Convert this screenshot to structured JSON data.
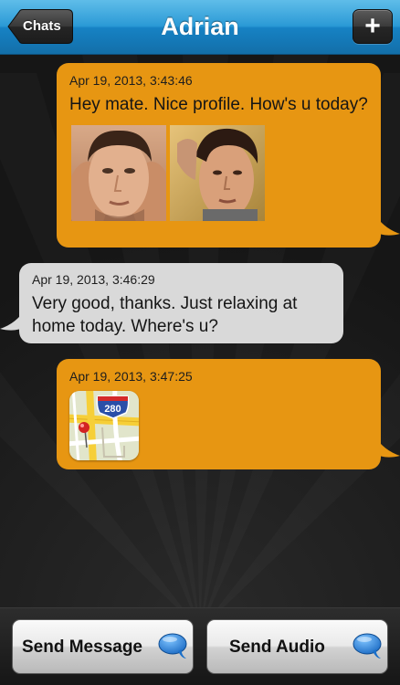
{
  "nav": {
    "back_label": "Chats",
    "title": "Adrian",
    "add_label": "+"
  },
  "messages": [
    {
      "direction": "outgoing",
      "timestamp": "Apr 19, 2013, 3:43:46",
      "text": "Hey mate. Nice profile. How's u today?",
      "attachments": [
        "profile-photo",
        "profile-photo"
      ]
    },
    {
      "direction": "incoming",
      "timestamp": "Apr 19, 2013, 3:46:29",
      "text": "Very good, thanks. Just relaxing at home today. Where's u?"
    },
    {
      "direction": "outgoing",
      "timestamp": "Apr 19, 2013, 3:47:25",
      "attachments": [
        "map-location"
      ],
      "map_route_label": "280"
    }
  ],
  "bottom": {
    "send_message_label": "Send Message",
    "send_audio_label": "Send Audio"
  },
  "colors": {
    "nav_blue": "#2b9ad6",
    "outgoing_bubble": "#e79612",
    "incoming_bubble": "#d9d9d9",
    "background": "#191919",
    "speech_icon_blue": "#1f7fd6"
  },
  "icons": [
    "back-arrow-icon",
    "plus-icon",
    "speech-bubble-icon",
    "map-pin-icon"
  ]
}
